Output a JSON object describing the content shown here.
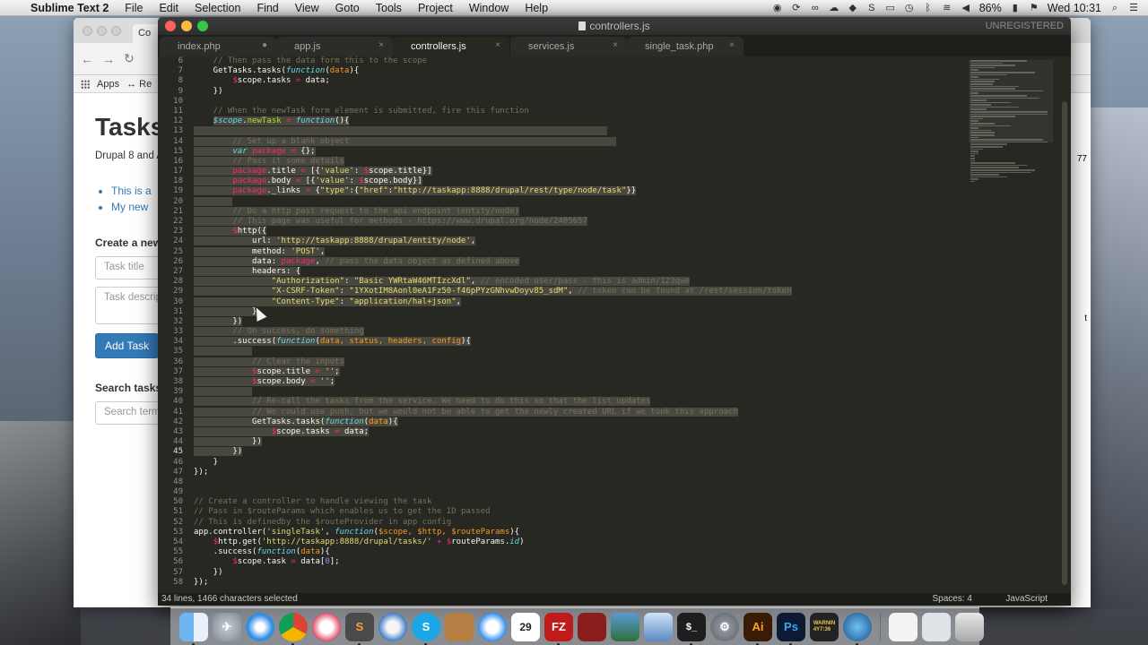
{
  "menubar": {
    "app": "Sublime Text 2",
    "items": [
      "File",
      "Edit",
      "Selection",
      "Find",
      "View",
      "Goto",
      "Tools",
      "Project",
      "Window",
      "Help"
    ],
    "battery": "86%",
    "clock": "Wed 10:31"
  },
  "browser": {
    "tab_label": "Co",
    "bookmark_apps": "Apps",
    "bookmark_other": "Re",
    "title": "Tasks",
    "subtitle": "Drupal 8 and A",
    "links": [
      "This is a",
      "My new"
    ],
    "create_heading": "Create a new",
    "task_title_placeholder": "Task title",
    "task_desc_placeholder": "Task descrip",
    "add_button": "Add Task",
    "search_heading": "Search tasks",
    "search_placeholder": "Search term",
    "edge_nums": [
      "77",
      "t"
    ]
  },
  "editor": {
    "window_title": "controllers.js",
    "unregistered": "UNREGISTERED",
    "tabs": [
      {
        "label": "index.php",
        "close": "●"
      },
      {
        "label": "app.js",
        "close": "×"
      },
      {
        "label": "controllers.js",
        "close": "×"
      },
      {
        "label": "services.js",
        "close": "×"
      },
      {
        "label": "single_task.php",
        "close": "×"
      }
    ],
    "line_numbers": [
      "6",
      "7",
      "8",
      "9",
      "10",
      "11",
      "12",
      "13",
      "14",
      "15",
      "16",
      "17",
      "18",
      "19",
      "20",
      "21",
      "22",
      "23",
      "24",
      "25",
      "26",
      "27",
      "28",
      "29",
      "30",
      "31",
      "32",
      "33",
      "34",
      "35",
      "36",
      "37",
      "38",
      "39",
      "40",
      "41",
      "42",
      "43",
      "44",
      "45",
      "46",
      "47",
      "48",
      "49",
      "50",
      "51",
      "52",
      "53",
      "54",
      "55",
      "56",
      "57",
      "58"
    ],
    "status_left": "34 lines, 1466 characters selected",
    "status_spaces": "Spaces: 4",
    "status_syntax": "JavaScript"
  },
  "dock": {
    "apps": [
      "finder-icon",
      "launchpad-icon",
      "safari-icon",
      "chrome-icon",
      "itunes-icon",
      "sublime-icon",
      "sequel-icon",
      "skype-icon",
      "notes-icon",
      "messages-icon",
      "calendar-icon",
      "filezilla-icon",
      "photobooth-icon",
      "preview-icon",
      "keynote-icon",
      "terminal-icon",
      "settings-icon",
      "illustrator-icon",
      "photoshop-icon",
      "console-icon",
      "quicktime-icon",
      "document-icon",
      "screenshot-icon",
      "trash-icon"
    ],
    "calendar_day": "29",
    "ai_label": "Ai",
    "ps_label": "Ps",
    "fz_label": "FZ",
    "console_label": "WARNIN\n4Y7:36",
    "sublime_label": "S",
    "skype_label": "S",
    "terminal_label": "$_"
  }
}
